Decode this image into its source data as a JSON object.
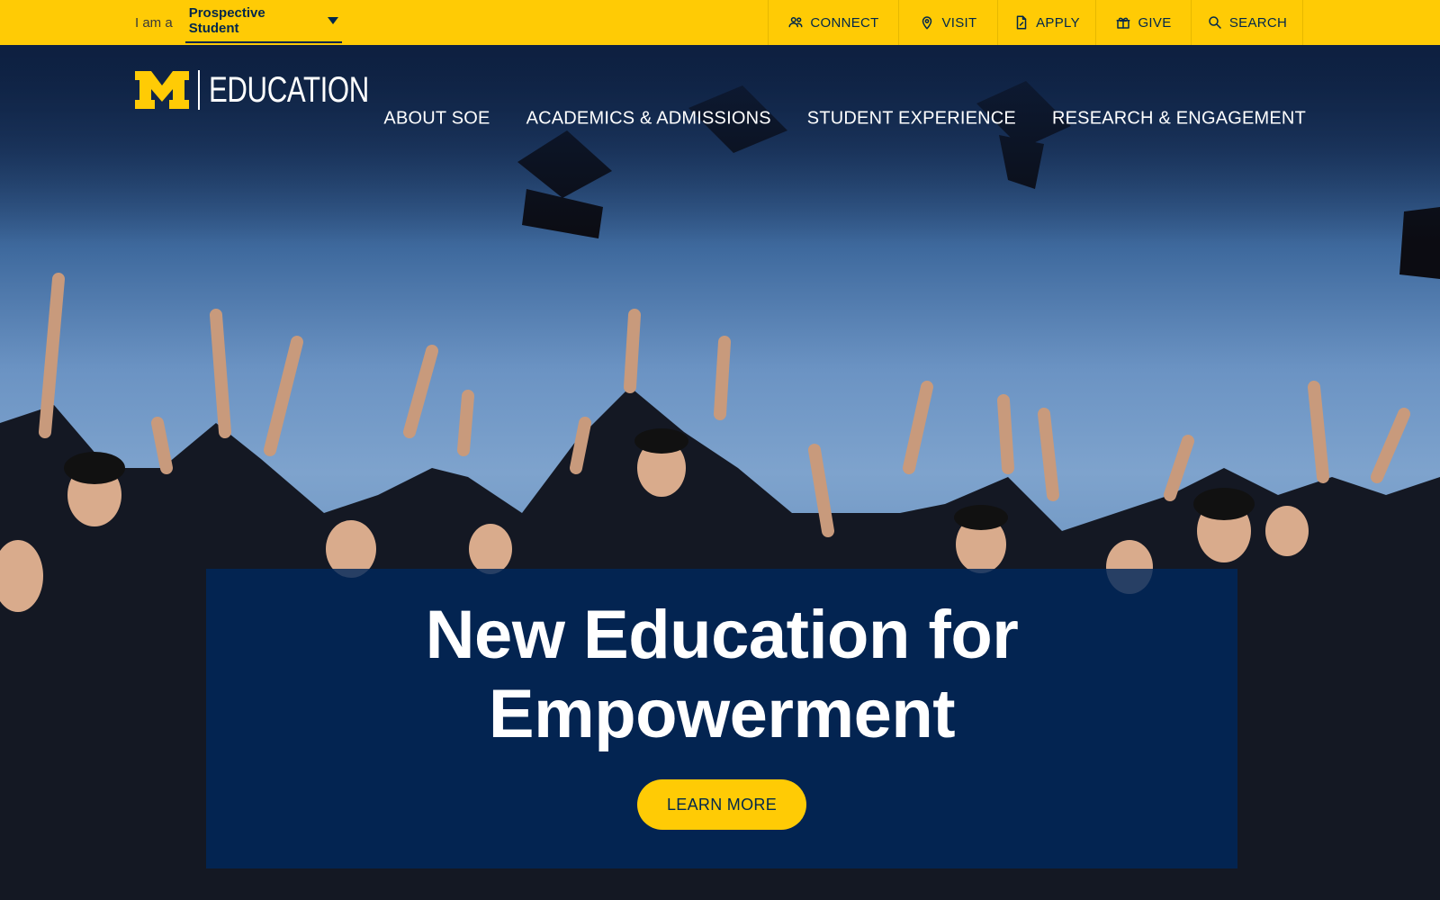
{
  "utility_bar": {
    "audience_lead": "I am a",
    "audience_selected": "Prospective Student",
    "links": [
      {
        "label": "CONNECT",
        "icon": "people-icon"
      },
      {
        "label": "VISIT",
        "icon": "map-pin-icon"
      },
      {
        "label": "APPLY",
        "icon": "document-icon"
      },
      {
        "label": "GIVE",
        "icon": "gift-icon"
      },
      {
        "label": "SEARCH",
        "icon": "search-icon"
      }
    ]
  },
  "brand": {
    "logo_mark": "M",
    "logo_word": "EDUCATION",
    "maize": "#ffcb05",
    "blue": "#00274c"
  },
  "nav": {
    "items": [
      {
        "label": "ABOUT SOE"
      },
      {
        "label": "ACADEMICS & ADMISSIONS"
      },
      {
        "label": "STUDENT EXPERIENCE"
      },
      {
        "label": "RESEARCH & ENGAGEMENT"
      }
    ]
  },
  "hero": {
    "title": "New Education for Empowerment",
    "cta_label": "LEARN MORE"
  }
}
